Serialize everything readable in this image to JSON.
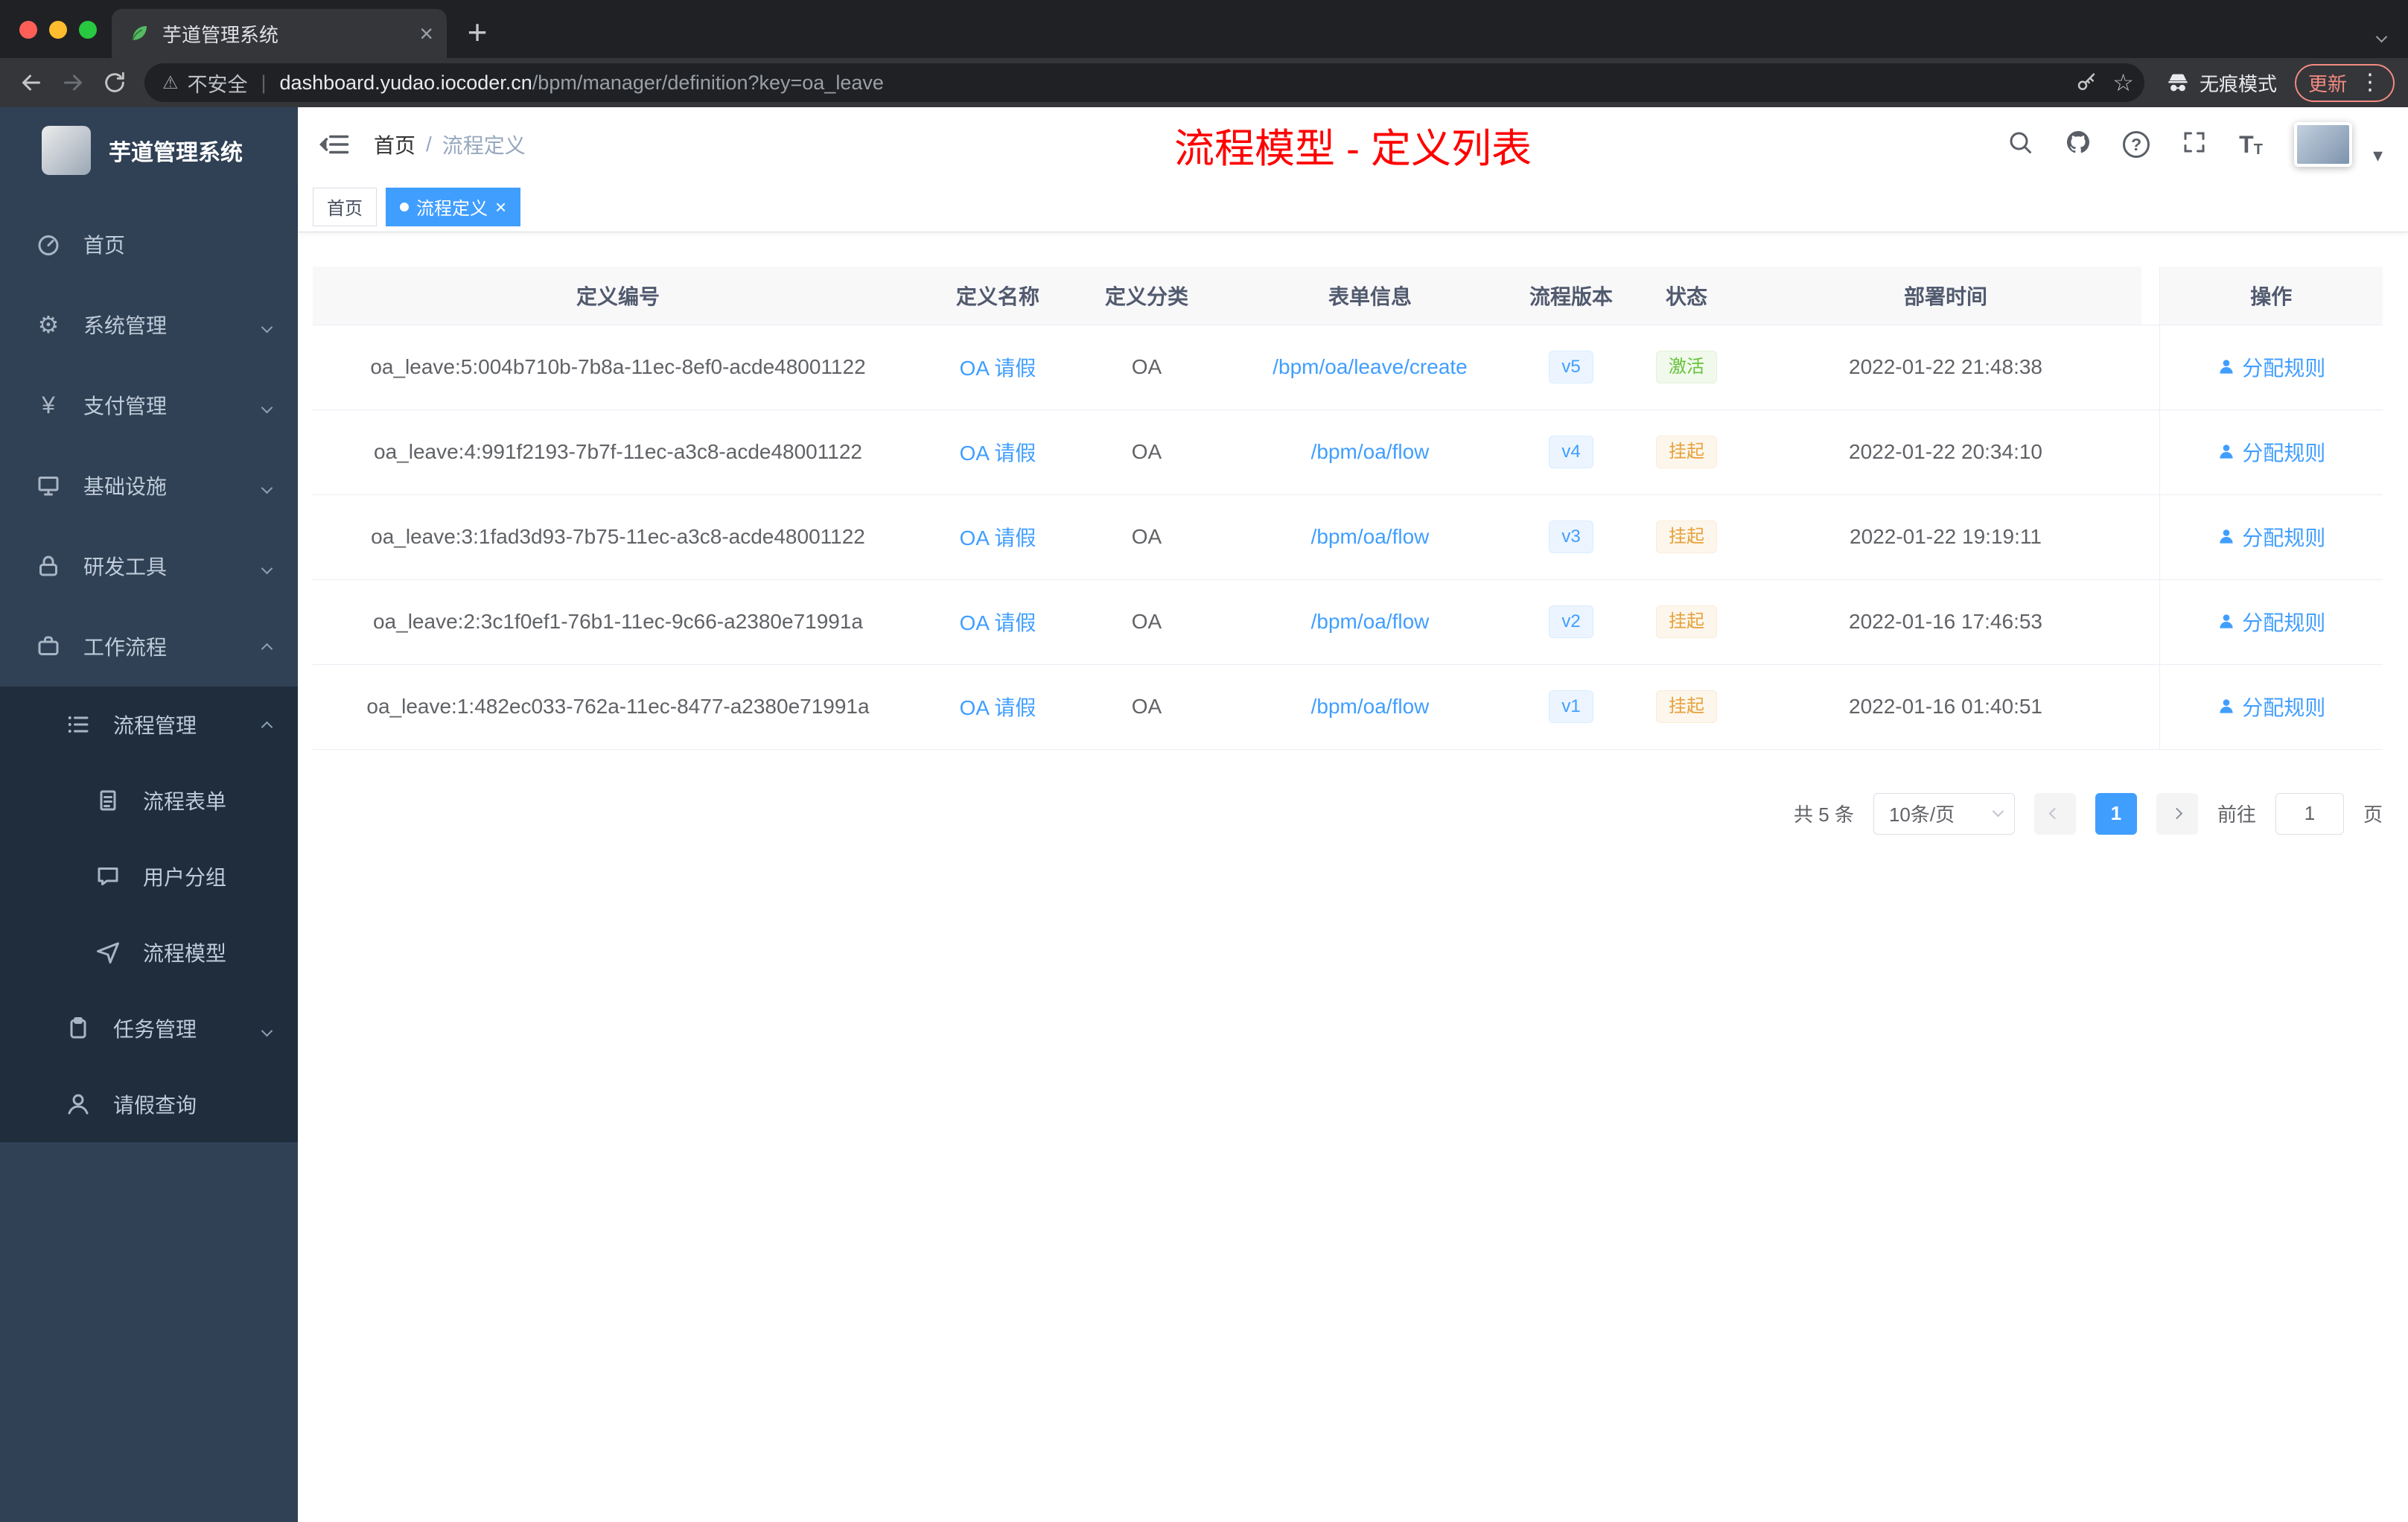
{
  "browser": {
    "tab_title": "芋道管理系统",
    "security_label": "不安全",
    "url_host": "dashboard.yudao.iocoder.cn",
    "url_path": "/bpm/manager/definition?key=oa_leave",
    "incognito_label": "无痕模式",
    "update_label": "更新"
  },
  "glyphs": {
    "close": "×",
    "new_tab": "+",
    "warning": "⚠",
    "pipe": "|",
    "star": "☆",
    "kebab": "⋮",
    "gear": "⚙",
    "yen": "¥",
    "question": "?",
    "font_big": "T",
    "font_small": "T",
    "caret": "▾"
  },
  "sidebar": {
    "logo_title": "芋道管理系统",
    "items": [
      {
        "label": "首页"
      },
      {
        "label": "系统管理"
      },
      {
        "label": "支付管理"
      },
      {
        "label": "基础设施"
      },
      {
        "label": "研发工具"
      },
      {
        "label": "工作流程"
      },
      {
        "label": "流程管理"
      },
      {
        "label": "流程表单"
      },
      {
        "label": "用户分组"
      },
      {
        "label": "流程模型"
      },
      {
        "label": "任务管理"
      },
      {
        "label": "请假查询"
      }
    ]
  },
  "header": {
    "breadcrumb_home": "首页",
    "breadcrumb_sep": "/",
    "breadcrumb_current": "流程定义",
    "page_title": "流程模型 - 定义列表"
  },
  "tags": {
    "home": "首页",
    "current": "流程定义"
  },
  "table": {
    "headers": [
      "定义编号",
      "定义名称",
      "定义分类",
      "表单信息",
      "流程版本",
      "状态",
      "部署时间",
      "操作"
    ],
    "action_label": "分配规则",
    "rows": [
      {
        "id": "oa_leave:5:004b710b-7b8a-11ec-8ef0-acde48001122",
        "name": "OA 请假",
        "category": "OA",
        "form": "/bpm/oa/leave/create",
        "version": "v5",
        "status": "激活",
        "time": "2022-01-22 21:48:38"
      },
      {
        "id": "oa_leave:4:991f2193-7b7f-11ec-a3c8-acde48001122",
        "name": "OA 请假",
        "category": "OA",
        "form": "/bpm/oa/flow",
        "version": "v4",
        "status": "挂起",
        "time": "2022-01-22 20:34:10"
      },
      {
        "id": "oa_leave:3:1fad3d93-7b75-11ec-a3c8-acde48001122",
        "name": "OA 请假",
        "category": "OA",
        "form": "/bpm/oa/flow",
        "version": "v3",
        "status": "挂起",
        "time": "2022-01-22 19:19:11"
      },
      {
        "id": "oa_leave:2:3c1f0ef1-76b1-11ec-9c66-a2380e71991a",
        "name": "OA 请假",
        "category": "OA",
        "form": "/bpm/oa/flow",
        "version": "v2",
        "status": "挂起",
        "time": "2022-01-16 17:46:53"
      },
      {
        "id": "oa_leave:1:482ec033-762a-11ec-8477-a2380e71991a",
        "name": "OA 请假",
        "category": "OA",
        "form": "/bpm/oa/flow",
        "version": "v1",
        "status": "挂起",
        "time": "2022-01-16 01:40:51"
      }
    ]
  },
  "pagination": {
    "total": "共 5 条",
    "page_size": "10条/页",
    "current_page": "1",
    "goto_label": "前往",
    "goto_value": "1",
    "page_unit": "页"
  },
  "colors": {
    "accent": "#409eff",
    "title_red": "#ff0000",
    "status_active": "#67c23a",
    "status_suspended": "#e6a23c",
    "sidebar_bg": "#304156",
    "submenu_bg": "#1f2d3d"
  }
}
